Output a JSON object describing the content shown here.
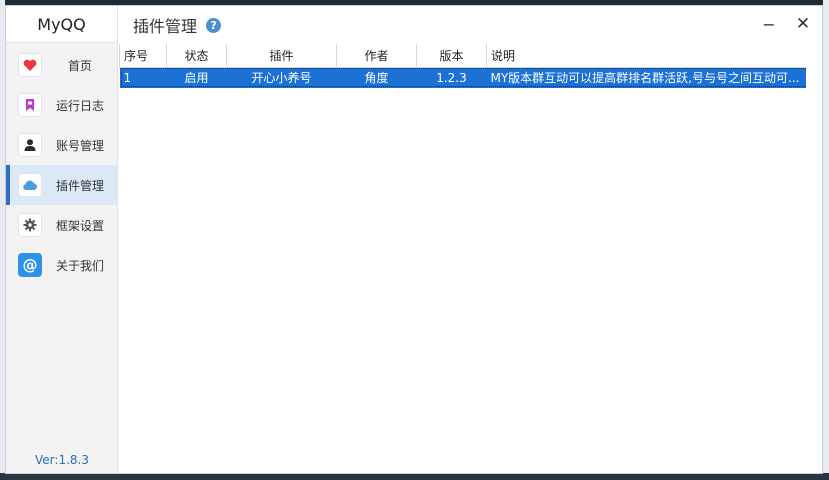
{
  "app": {
    "name": "MyQQ",
    "version": "Ver:1.8.3"
  },
  "window": {
    "title": "插件管理",
    "minimize": "−",
    "close": "✕",
    "help": "?"
  },
  "sidebar": {
    "items": [
      {
        "label": "首页",
        "icon": "heart-icon",
        "color": "#e8383d"
      },
      {
        "label": "运行日志",
        "icon": "bookmark-icon",
        "color": "#c03bc9"
      },
      {
        "label": "账号管理",
        "icon": "user-icon",
        "color": "#2b2b2b"
      },
      {
        "label": "插件管理",
        "icon": "cloud-icon",
        "color": "#4a9de0"
      },
      {
        "label": "框架设置",
        "icon": "gear-icon",
        "color": "#555555"
      },
      {
        "label": "关于我们",
        "icon": "at-icon",
        "color": "#2e93e6"
      }
    ],
    "active_index": 3
  },
  "table": {
    "columns": [
      "序号",
      "状态",
      "插件",
      "作者",
      "版本",
      "说明"
    ],
    "rows": [
      [
        "1",
        "启用",
        "开心小养号",
        "角度",
        "1.2.3",
        "MY版本群互动可以提高群排名群活跃,号与号之间互动可..."
      ]
    ],
    "selected_row": 0
  },
  "colors": {
    "accent": "#1c72d4",
    "active_nav_bg": "#dce9f8",
    "version_text": "#2b6fb8"
  }
}
